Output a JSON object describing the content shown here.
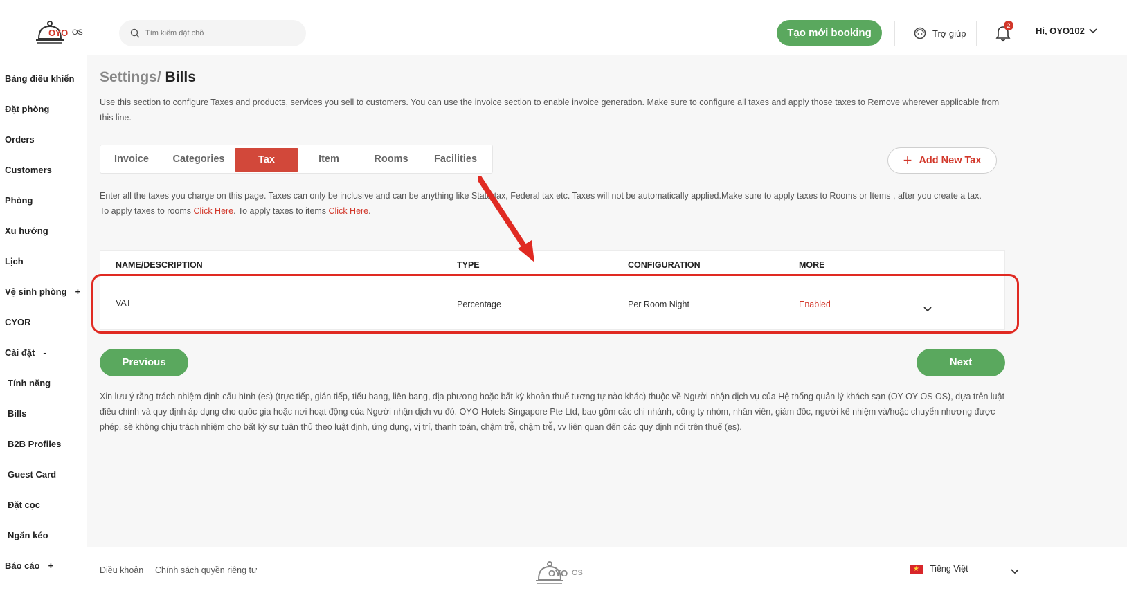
{
  "header": {
    "logo_text": "OYO",
    "logo_os": "OS",
    "search_placeholder": "Tìm kiếm đặt chỗ",
    "create_booking_label": "Tạo mới booking",
    "help_label": "Trợ giúp",
    "notification_count": "2",
    "user_greeting": "Hi, OYO102"
  },
  "sidebar": {
    "items": [
      {
        "label": "Bảng điều khiển"
      },
      {
        "label": "Đặt phòng"
      },
      {
        "label": "Orders"
      },
      {
        "label": "Customers"
      },
      {
        "label": "Phòng"
      },
      {
        "label": "Xu hướng"
      },
      {
        "label": "Lịch"
      },
      {
        "label": "Vệ sinh phòng",
        "toggle": "+"
      },
      {
        "label": "CYOR"
      },
      {
        "label": "Cài đặt",
        "toggle": "-"
      },
      {
        "label": "Tính năng"
      },
      {
        "label": "Bills"
      },
      {
        "label": "B2B Profiles"
      },
      {
        "label": "Guest Card"
      },
      {
        "label": "Đặt cọc"
      },
      {
        "label": "Ngăn kéo"
      },
      {
        "label": "Báo cáo",
        "toggle": "+"
      }
    ]
  },
  "breadcrumb": {
    "parent": "Settings/",
    "current": "Bills"
  },
  "intro_text": "Use this section to configure Taxes and products, services you sell to customers. You can use the invoice section to enable invoice generation. Make sure to configure all taxes and apply those taxes to Remove wherever applicable from this line.",
  "tabs": [
    {
      "label": "Invoice"
    },
    {
      "label": "Categories"
    },
    {
      "label": "Tax",
      "active": true
    },
    {
      "label": "Item"
    },
    {
      "label": "Rooms"
    },
    {
      "label": "Facilities"
    }
  ],
  "add_tax_label": "Add New Tax",
  "tax_info": {
    "line1": "Enter all the taxes you charge on this page. Taxes can only be inclusive and can be anything like State tax, Federal tax etc. Taxes will not be automatically applied.Make sure to apply taxes to Rooms or Items , after you create a tax.",
    "rooms_prefix": "To apply taxes to rooms ",
    "rooms_link": "Click Here",
    "items_prefix": ". To apply taxes to items ",
    "items_link": "Click Here",
    "suffix": "."
  },
  "table": {
    "headers": [
      "NAME/DESCRIPTION",
      "TYPE",
      "CONFIGURATION",
      "MORE"
    ],
    "rows": [
      {
        "name": "VAT",
        "type": "Percentage",
        "configuration": "Per Room Night",
        "status": "Enabled"
      }
    ]
  },
  "previous_label": "Previous",
  "next_label": "Next",
  "disclaimer": "Xin lưu ý rằng trách nhiệm định cấu hình (es) (trực tiếp, gián tiếp, tiểu bang, liên bang, địa phương hoặc bất kỳ khoản thuế tương tự nào khác) thuộc về Người nhận dịch vụ của Hệ thống quản lý khách sạn (OY OY OS OS), dựa trên luật điều chỉnh và quy định áp dụng cho quốc gia hoặc nơi hoạt động của Người nhận dịch vụ đó. OYO Hotels Singapore Pte Ltd, bao gồm các chi nhánh, công ty nhóm, nhân viên, giám đốc, người kế nhiệm và/hoặc chuyển nhượng được phép, sẽ không chịu trách nhiệm cho bất kỳ sự tuân thủ theo luật định, ứng dụng, vị trí, thanh toán, chậm trễ, chậm trễ, vv liên quan đến các quy định nói trên thuế (es).",
  "footer": {
    "terms": "Điều khoản",
    "privacy": "Chính sách quyền riêng tư",
    "logo_text": "OYO",
    "logo_os": "OS",
    "language": "Tiếng Việt"
  },
  "colors": {
    "brand_red": "#d2372a",
    "primary_green": "#5aa85e",
    "highlight_red": "#e02a22"
  }
}
